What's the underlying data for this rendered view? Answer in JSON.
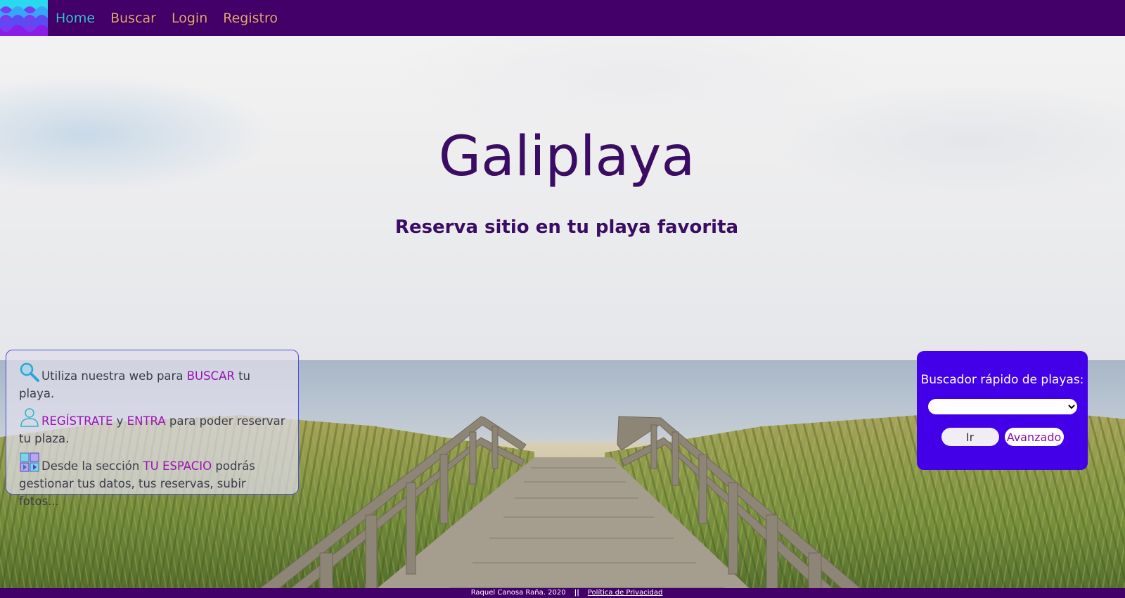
{
  "nav": {
    "logo": "wave-logo",
    "items": [
      {
        "label": "Home",
        "active": true
      },
      {
        "label": "Buscar",
        "active": false
      },
      {
        "label": "Login",
        "active": false
      },
      {
        "label": "Registro",
        "active": false
      }
    ]
  },
  "hero": {
    "title": "Galiplaya",
    "subtitle": "Reserva sitio en tu playa favorita"
  },
  "info": {
    "line1": {
      "icon": "magnifier-icon",
      "pre": "Utiliza nuestra web para ",
      "highlight": "BUSCAR",
      "post": " tu playa."
    },
    "line2": {
      "icon": "user-icon",
      "highlight1": "REGÍSTRATE",
      "mid": " y ",
      "highlight2": "ENTRA",
      "post": " para poder reservar tu plaza."
    },
    "line3": {
      "icon": "grid-icon",
      "pre": "Desde la sección ",
      "highlight": "TU ESPACIO",
      "post": " podrás gestionar tus datos, tus reservas, subir fotos..."
    }
  },
  "quick_search": {
    "label": "Buscador rápido de playas:",
    "selected_value": "",
    "go_label": "Ir",
    "advanced_label": "Avanzado"
  },
  "footer": {
    "credit": "Raquel Canosa Raña. 2020",
    "separator": "||",
    "privacy_link": "Política de Privacidad"
  },
  "colors": {
    "navbar": "#430068",
    "nav_link": "#e8a27c",
    "nav_active": "#3fb9e0",
    "title": "#3a0c63",
    "highlight": "#9a12b5",
    "search_box": "#4300e8"
  }
}
